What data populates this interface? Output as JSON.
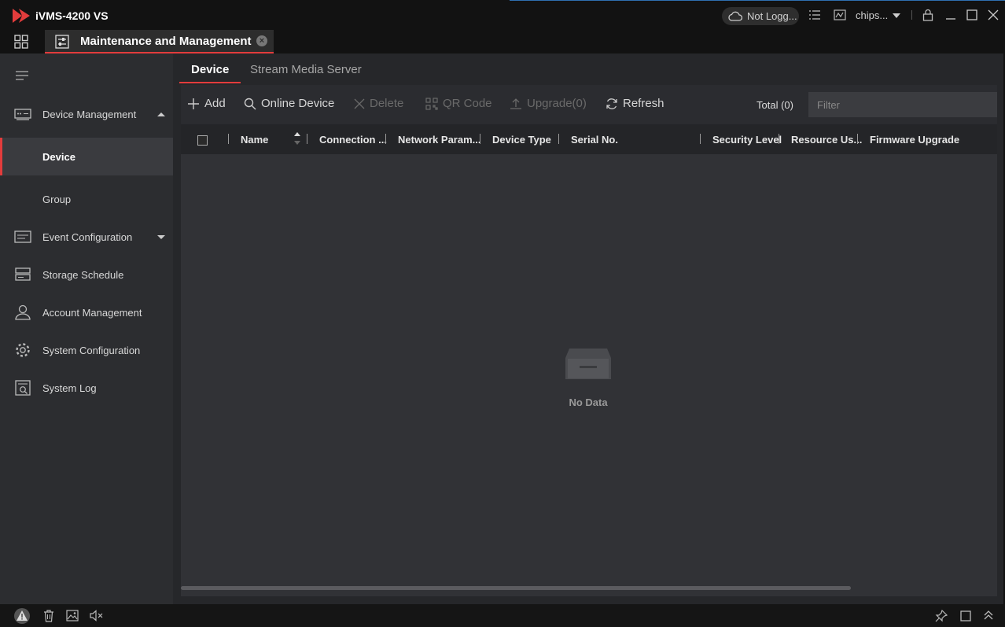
{
  "app": {
    "title": "iVMS-4200 VS",
    "login_status": "Not Logg...",
    "user": "chips..."
  },
  "module_tab": {
    "label": "Maintenance and Management",
    "close_glyph": "×"
  },
  "sidebar": {
    "items": [
      {
        "label": "Device Management",
        "icon": "device-management-icon"
      },
      {
        "label": "Device"
      },
      {
        "label": "Group"
      },
      {
        "label": "Event Configuration",
        "icon": "event-configuration-icon"
      },
      {
        "label": "Storage Schedule",
        "icon": "storage-schedule-icon"
      },
      {
        "label": "Account Management",
        "icon": "account-icon"
      },
      {
        "label": "System Configuration",
        "icon": "gear-icon"
      },
      {
        "label": "System Log",
        "icon": "system-log-icon"
      }
    ]
  },
  "subtabs": [
    "Device",
    "Stream Media Server"
  ],
  "toolbar": {
    "add": "Add",
    "online_device": "Online Device",
    "delete": "Delete",
    "qr_code": "QR Code",
    "upgrade": "Upgrade(0)",
    "refresh": "Refresh",
    "total": "Total (0)",
    "filter_placeholder": "Filter"
  },
  "table": {
    "columns": [
      "Name",
      "Connection ...",
      "Network Param...",
      "Device Type",
      "Serial No.",
      "Security Level",
      "Resource Us...",
      "Firmware Upgrade"
    ],
    "rows": [],
    "empty_text": "No Data"
  },
  "colors": {
    "accent": "#e33c3c",
    "background": "#26272a",
    "sidebar": "#2c2d30"
  }
}
